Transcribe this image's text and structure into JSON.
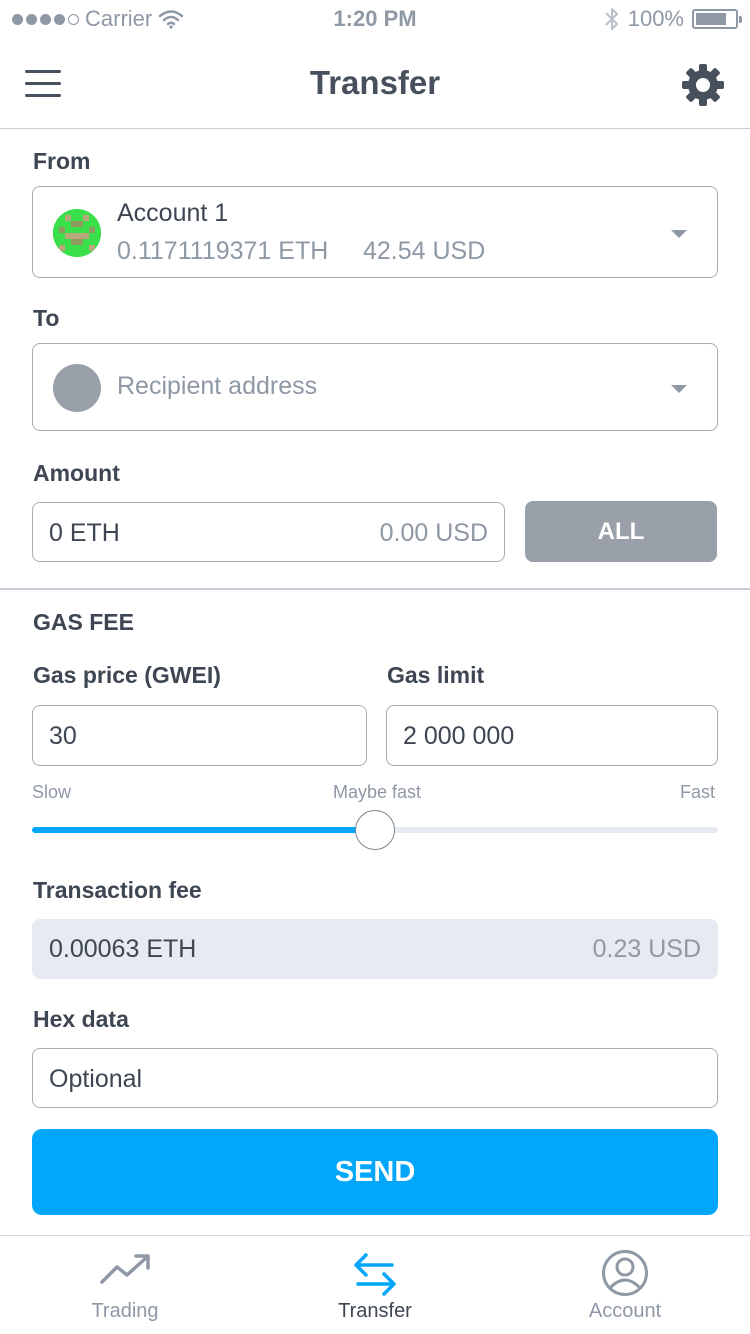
{
  "status_bar": {
    "carrier": "Carrier",
    "time": "1:20 PM",
    "battery": "100%"
  },
  "header": {
    "title": "Transfer",
    "menu_icon": "hamburger-icon",
    "settings_icon": "gear-icon"
  },
  "from": {
    "label": "From",
    "account_name": "Account 1",
    "balance_eth": "0.1171119371 ETH",
    "balance_usd": "42.54 USD"
  },
  "to": {
    "label": "To",
    "placeholder": "Recipient address"
  },
  "amount": {
    "label": "Amount",
    "value": "0 ETH",
    "usd": "0.00 USD",
    "all_button": "ALL"
  },
  "gas": {
    "section_title": "GAS FEE",
    "price_label": "Gas price (GWEI)",
    "price_value": "30",
    "limit_label": "Gas limit",
    "limit_value": "2 000 000",
    "slider": {
      "min_label": "Slow",
      "mid_label": "Maybe fast",
      "max_label": "Fast",
      "level": 0.5
    }
  },
  "fee": {
    "label": "Transaction fee",
    "eth": "0.00063 ETH",
    "usd": "0.23 USD"
  },
  "hex": {
    "label": "Hex data",
    "placeholder": "Optional"
  },
  "send_button": "SEND",
  "tabs": [
    {
      "label": "Trading",
      "icon": "trending-up-icon",
      "active": false
    },
    {
      "label": "Transfer",
      "icon": "transfer-arrows-icon",
      "active": true
    },
    {
      "label": "Account",
      "icon": "user-circle-icon",
      "active": false
    }
  ],
  "colors": {
    "accent": "#02a6fb",
    "text": "#3d4652",
    "muted": "#8f98a5",
    "button_gray": "#9aa0a9",
    "fee_bg": "#e7eaf0"
  }
}
